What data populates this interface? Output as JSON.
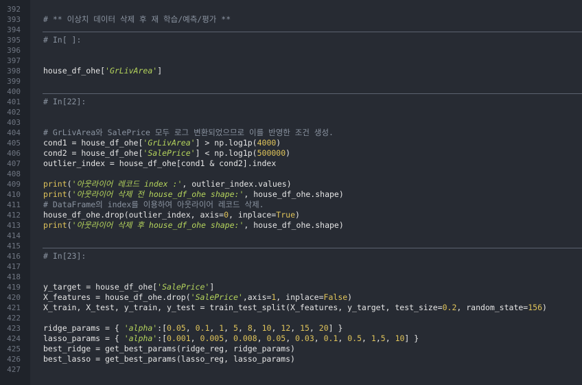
{
  "line_numbers": [
    "392",
    "393",
    "394",
    "395",
    "396",
    "397",
    "398",
    "399",
    "400",
    "401",
    "402",
    "403",
    "404",
    "405",
    "406",
    "407",
    "408",
    "409",
    "410",
    "411",
    "412",
    "413",
    "414",
    "415",
    "416",
    "417",
    "418",
    "419",
    "420",
    "421",
    "422",
    "423",
    "424",
    "425",
    "426",
    "427"
  ],
  "code_lines": [
    {
      "id": "393",
      "tokens": [
        {
          "c": "cm",
          "t": "# ** 이상치 데이터 삭제 후 재 학습/예측/평가 **"
        }
      ]
    },
    {
      "id": "395",
      "tokens": [
        {
          "c": "cm",
          "t": "# In[ ]:"
        }
      ]
    },
    {
      "id": "398",
      "tokens": [
        {
          "c": "",
          "t": "house_df_ohe["
        },
        {
          "c": "str",
          "t": "'GrLivArea'"
        },
        {
          "c": "",
          "t": "]"
        }
      ]
    },
    {
      "id": "401",
      "tokens": [
        {
          "c": "cm",
          "t": "# In[22]:"
        }
      ]
    },
    {
      "id": "404",
      "tokens": [
        {
          "c": "cm",
          "t": "# GrLivArea와 SalePrice 모두 로그 변환되었으므로 이를 반영한 조건 생성."
        }
      ]
    },
    {
      "id": "405",
      "tokens": [
        {
          "c": "",
          "t": "cond1 = house_df_ohe["
        },
        {
          "c": "str",
          "t": "'GrLivArea'"
        },
        {
          "c": "",
          "t": "] > np.log1p("
        },
        {
          "c": "num",
          "t": "4000"
        },
        {
          "c": "",
          "t": ")"
        }
      ]
    },
    {
      "id": "406",
      "tokens": [
        {
          "c": "",
          "t": "cond2 = house_df_ohe["
        },
        {
          "c": "str",
          "t": "'SalePrice'"
        },
        {
          "c": "",
          "t": "] < np.log1p("
        },
        {
          "c": "num",
          "t": "500000"
        },
        {
          "c": "",
          "t": ")"
        }
      ]
    },
    {
      "id": "407",
      "tokens": [
        {
          "c": "",
          "t": "outlier_index = house_df_ohe[cond1 & cond2].index"
        }
      ]
    },
    {
      "id": "409",
      "tokens": [
        {
          "c": "fn",
          "t": "print"
        },
        {
          "c": "",
          "t": "("
        },
        {
          "c": "str",
          "t": "'아웃라이어 레코드 index :'"
        },
        {
          "c": "",
          "t": ", outlier_index.values)"
        }
      ]
    },
    {
      "id": "410",
      "tokens": [
        {
          "c": "fn",
          "t": "print"
        },
        {
          "c": "",
          "t": "("
        },
        {
          "c": "str",
          "t": "'아웃라이어 삭제 전 house_df_ohe shape:'"
        },
        {
          "c": "",
          "t": ", house_df_ohe.shape)"
        }
      ]
    },
    {
      "id": "411",
      "tokens": [
        {
          "c": "cm",
          "t": "# DataFrame의 index를 이용하여 아웃라이어 레코드 삭제."
        }
      ]
    },
    {
      "id": "412",
      "tokens": [
        {
          "c": "",
          "t": "house_df_ohe.drop(outlier_index, axis="
        },
        {
          "c": "num",
          "t": "0"
        },
        {
          "c": "",
          "t": ", inplace="
        },
        {
          "c": "kw",
          "t": "True"
        },
        {
          "c": "",
          "t": ")"
        }
      ]
    },
    {
      "id": "413",
      "tokens": [
        {
          "c": "fn",
          "t": "print"
        },
        {
          "c": "",
          "t": "("
        },
        {
          "c": "str",
          "t": "'아웃라이어 삭제 후 house_df_ohe shape:'"
        },
        {
          "c": "",
          "t": ", house_df_ohe.shape)"
        }
      ]
    },
    {
      "id": "416",
      "tokens": [
        {
          "c": "cm",
          "t": "# In[23]:"
        }
      ]
    },
    {
      "id": "419",
      "tokens": [
        {
          "c": "",
          "t": "y_target = house_df_ohe["
        },
        {
          "c": "str",
          "t": "'SalePrice'"
        },
        {
          "c": "",
          "t": "]"
        }
      ]
    },
    {
      "id": "420",
      "tokens": [
        {
          "c": "",
          "t": "X_features = house_df_ohe.drop("
        },
        {
          "c": "str",
          "t": "'SalePrice'"
        },
        {
          "c": "",
          "t": ",axis="
        },
        {
          "c": "num",
          "t": "1"
        },
        {
          "c": "",
          "t": ", inplace="
        },
        {
          "c": "kw",
          "t": "False"
        },
        {
          "c": "",
          "t": ")"
        }
      ]
    },
    {
      "id": "421",
      "tokens": [
        {
          "c": "",
          "t": "X_train, X_test, y_train, y_test = train_test_split(X_features, y_target, test_size="
        },
        {
          "c": "num",
          "t": "0.2"
        },
        {
          "c": "",
          "t": ", random_state="
        },
        {
          "c": "num",
          "t": "156"
        },
        {
          "c": "",
          "t": ")"
        }
      ]
    },
    {
      "id": "423",
      "tokens": [
        {
          "c": "",
          "t": "ridge_params = { "
        },
        {
          "c": "str",
          "t": "'alpha'"
        },
        {
          "c": "",
          "t": ":["
        },
        {
          "c": "num",
          "t": "0.05"
        },
        {
          "c": "",
          "t": ", "
        },
        {
          "c": "num",
          "t": "0.1"
        },
        {
          "c": "",
          "t": ", "
        },
        {
          "c": "num",
          "t": "1"
        },
        {
          "c": "",
          "t": ", "
        },
        {
          "c": "num",
          "t": "5"
        },
        {
          "c": "",
          "t": ", "
        },
        {
          "c": "num",
          "t": "8"
        },
        {
          "c": "",
          "t": ", "
        },
        {
          "c": "num",
          "t": "10"
        },
        {
          "c": "",
          "t": ", "
        },
        {
          "c": "num",
          "t": "12"
        },
        {
          "c": "",
          "t": ", "
        },
        {
          "c": "num",
          "t": "15"
        },
        {
          "c": "",
          "t": ", "
        },
        {
          "c": "num",
          "t": "20"
        },
        {
          "c": "",
          "t": "] }"
        }
      ]
    },
    {
      "id": "424",
      "tokens": [
        {
          "c": "",
          "t": "lasso_params = { "
        },
        {
          "c": "str",
          "t": "'alpha'"
        },
        {
          "c": "",
          "t": ":["
        },
        {
          "c": "num",
          "t": "0.001"
        },
        {
          "c": "",
          "t": ", "
        },
        {
          "c": "num",
          "t": "0.005"
        },
        {
          "c": "",
          "t": ", "
        },
        {
          "c": "num",
          "t": "0.008"
        },
        {
          "c": "",
          "t": ", "
        },
        {
          "c": "num",
          "t": "0.05"
        },
        {
          "c": "",
          "t": ", "
        },
        {
          "c": "num",
          "t": "0.03"
        },
        {
          "c": "",
          "t": ", "
        },
        {
          "c": "num",
          "t": "0.1"
        },
        {
          "c": "",
          "t": ", "
        },
        {
          "c": "num",
          "t": "0.5"
        },
        {
          "c": "",
          "t": ", "
        },
        {
          "c": "num",
          "t": "1"
        },
        {
          "c": "",
          "t": ","
        },
        {
          "c": "num",
          "t": "5"
        },
        {
          "c": "",
          "t": ", "
        },
        {
          "c": "num",
          "t": "10"
        },
        {
          "c": "",
          "t": "] }"
        }
      ]
    },
    {
      "id": "425",
      "tokens": [
        {
          "c": "",
          "t": "best_ridge = get_best_params(ridge_reg, ridge_params)"
        }
      ]
    },
    {
      "id": "426",
      "tokens": [
        {
          "c": "",
          "t": "best_lasso = get_best_params(lasso_reg, lasso_params)"
        }
      ]
    }
  ],
  "cell_separators_after": [
    "394",
    "400",
    "415"
  ],
  "colors": {
    "background": "#272b33",
    "gutter": "#1f232a",
    "comment": "#8a93a0",
    "string": "#b5d45c",
    "number": "#e0c45a",
    "text": "#e6e6e6"
  }
}
